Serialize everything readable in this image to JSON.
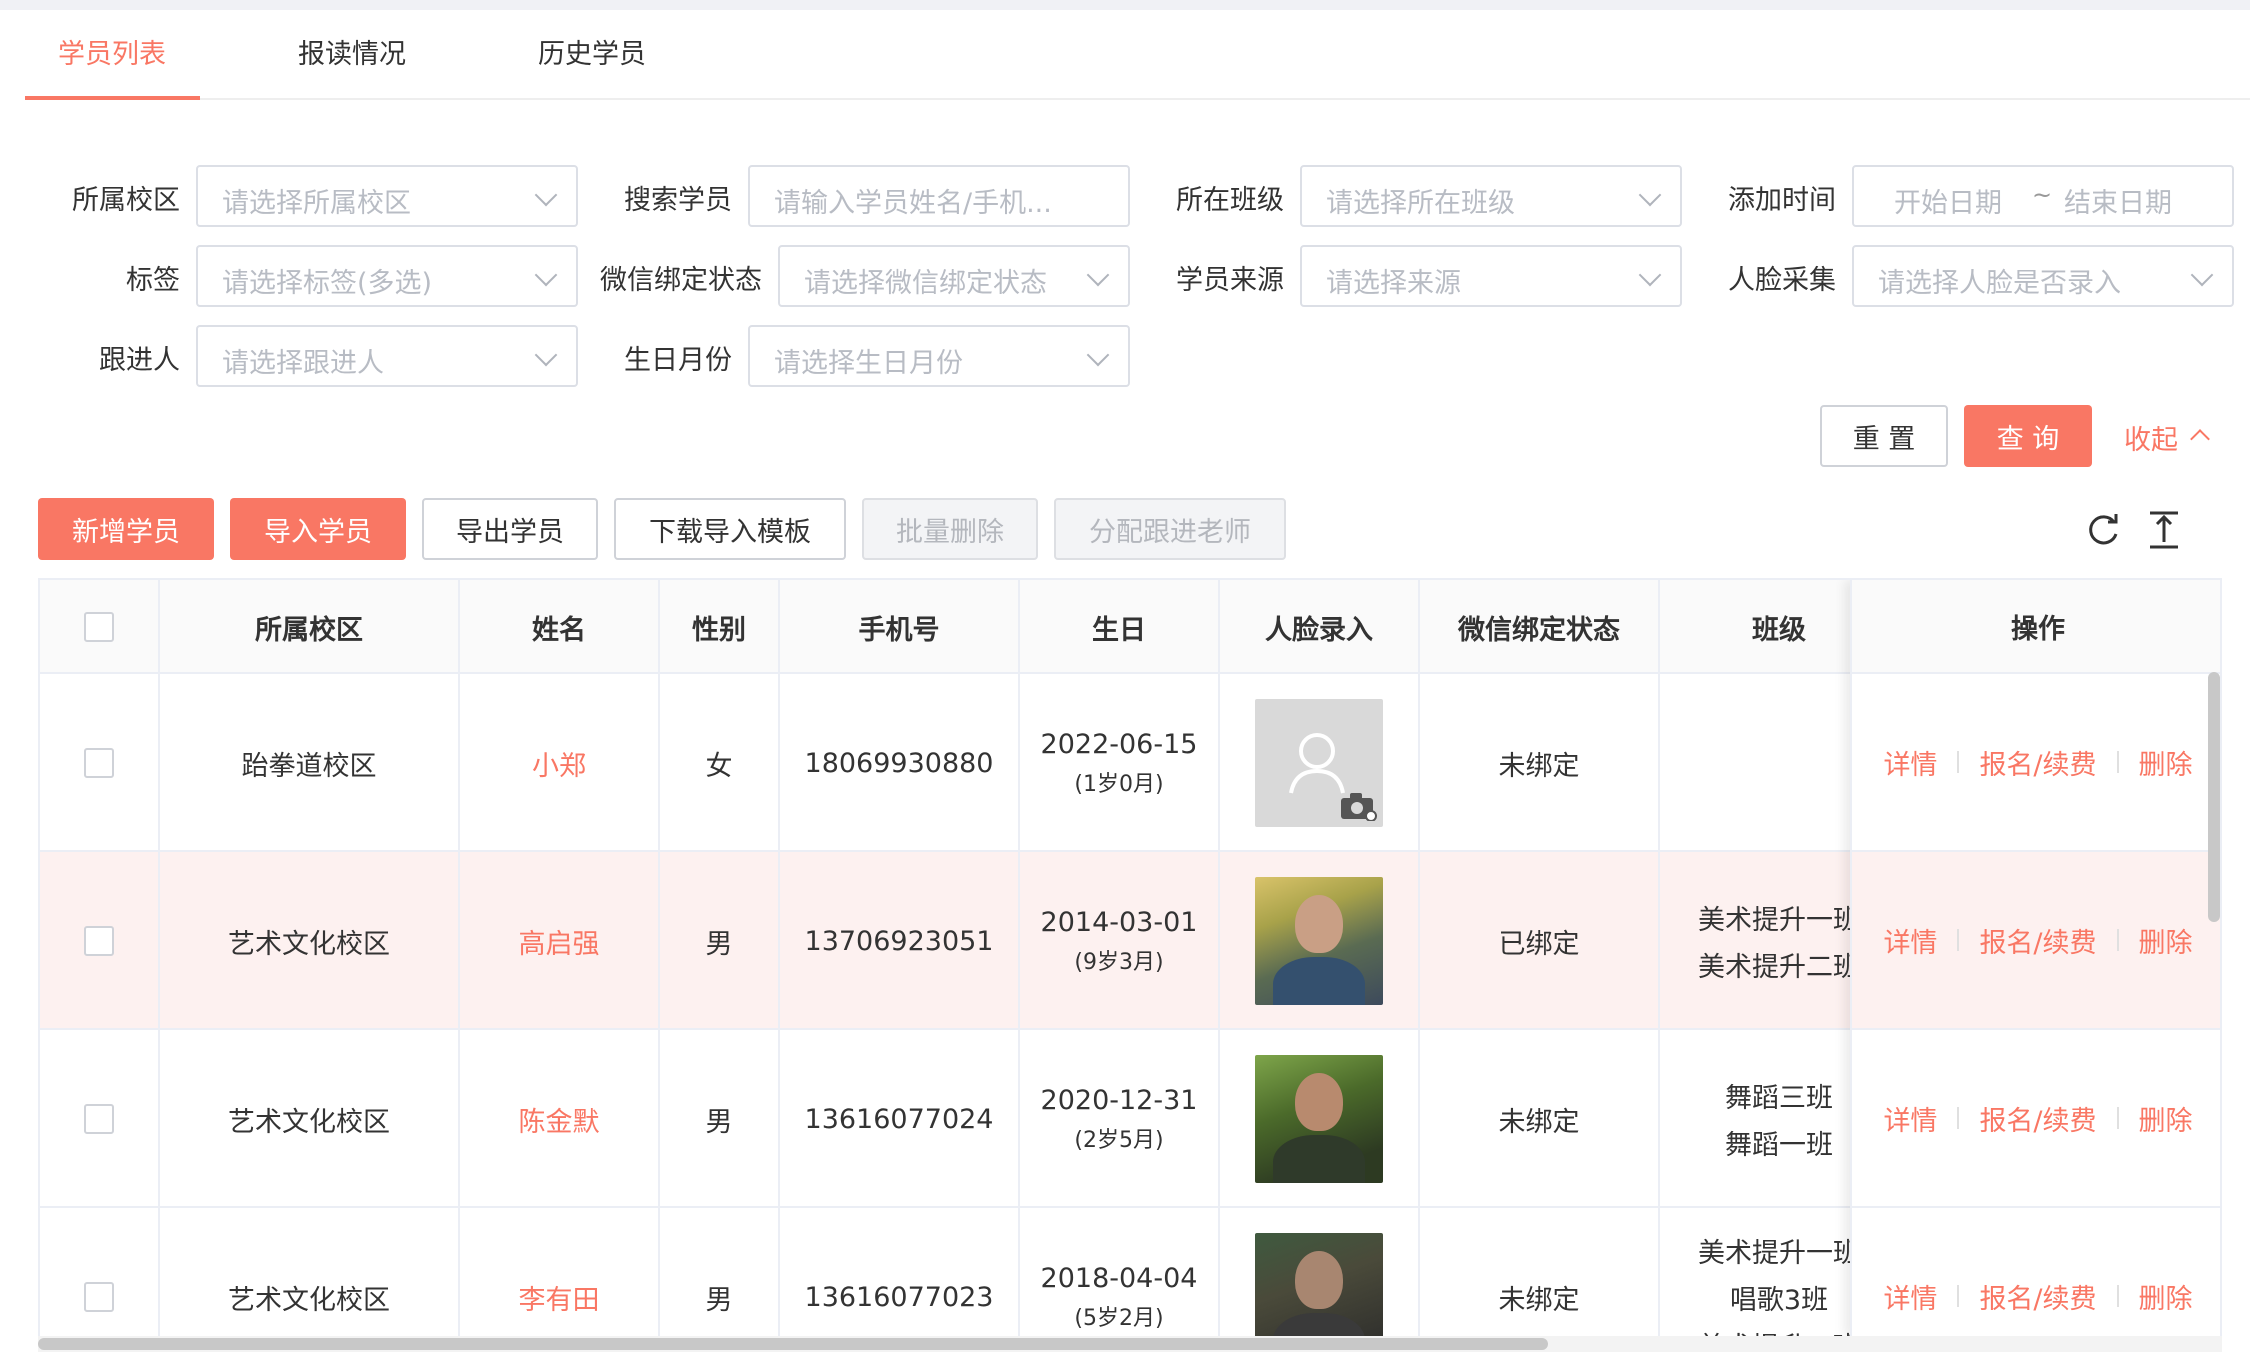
{
  "tabs": [
    {
      "label": "学员列表",
      "active": true
    },
    {
      "label": "报读情况",
      "active": false
    },
    {
      "label": "历史学员",
      "active": false
    }
  ],
  "filters": {
    "campus": {
      "label": "所属校区",
      "placeholder": "请选择所属校区"
    },
    "search": {
      "label": "搜索学员",
      "placeholder": "请输入学员姓名/手机..."
    },
    "class": {
      "label": "所在班级",
      "placeholder": "请选择所在班级"
    },
    "added_time": {
      "label": "添加时间",
      "start": "开始日期",
      "sep": "~",
      "end": "结束日期"
    },
    "tag": {
      "label": "标签",
      "placeholder": "请选择标签(多选)"
    },
    "wechat": {
      "label": "微信绑定状态",
      "placeholder": "请选择微信绑定状态"
    },
    "source": {
      "label": "学员来源",
      "placeholder": "请选择来源"
    },
    "face": {
      "label": "人脸采集",
      "placeholder": "请选择人脸是否录入"
    },
    "follower": {
      "label": "跟进人",
      "placeholder": "请选择跟进人"
    },
    "birth_month": {
      "label": "生日月份",
      "placeholder": "请选择生日月份"
    }
  },
  "filter_actions": {
    "reset": "重 置",
    "query": "查 询",
    "collapse": "收起"
  },
  "toolbar": {
    "add": "新增学员",
    "import": "导入学员",
    "export": "导出学员",
    "download_template": "下载导入模板",
    "batch_delete": "批量删除",
    "assign_teacher": "分配跟进老师"
  },
  "colors": {
    "accent": "#f97764",
    "row_highlight": "#fdf1f0",
    "border": "#ebeef5"
  },
  "table": {
    "headers": {
      "campus": "所属校区",
      "name": "姓名",
      "gender": "性别",
      "phone": "手机号",
      "birthday": "生日",
      "face": "人脸录入",
      "wechat": "微信绑定状态",
      "class": "班级",
      "ops": "操作"
    },
    "rows": [
      {
        "campus": "跆拳道校区",
        "name": "小郑",
        "gender": "女",
        "phone": "18069930880",
        "birthday": "2022-06-15",
        "age": "(1岁0月)",
        "face": "placeholder",
        "wechat": "未绑定",
        "class1": "",
        "class2": "",
        "highlight": false
      },
      {
        "campus": "艺术文化校区",
        "name": "高启强",
        "gender": "男",
        "phone": "13706923051",
        "birthday": "2014-03-01",
        "age": "(9岁3月)",
        "face": "photo",
        "wechat": "已绑定",
        "class1": "美术提升一班",
        "class2": "美术提升二班",
        "highlight": true
      },
      {
        "campus": "艺术文化校区",
        "name": "陈金默",
        "gender": "男",
        "phone": "13616077024",
        "birthday": "2020-12-31",
        "age": "(2岁5月)",
        "face": "photo",
        "wechat": "未绑定",
        "class1": "舞蹈三班",
        "class2": "舞蹈一班",
        "highlight": false
      },
      {
        "campus": "艺术文化校区",
        "name": "李有田",
        "gender": "男",
        "phone": "13616077023",
        "birthday": "2018-04-04",
        "age": "(5岁2月)",
        "face": "photo",
        "wechat": "未绑定",
        "class1": "美术提升一班",
        "class2": "唱歌3班",
        "class3": "美术提升二班",
        "highlight": false
      }
    ],
    "ops": {
      "detail": "详情",
      "enroll": "报名/续费",
      "delete": "删除"
    }
  }
}
